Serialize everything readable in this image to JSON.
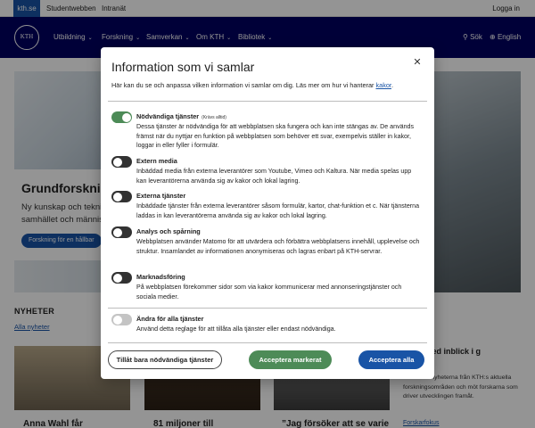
{
  "topbar": {
    "kth": "kth.se",
    "studentwebben": "Studentwebben",
    "intranat": "Intranät",
    "login": "Logga in"
  },
  "logo_text": "KTH",
  "nav": {
    "items": [
      "Utbildning",
      "Forskning",
      "Samverkan",
      "Om KTH",
      "Bibliotek"
    ],
    "search": "Sök",
    "language": "English"
  },
  "hero": {
    "title": "Grundforskni",
    "text": "Ny kunskap och tekni samhället och männis",
    "button": "Forskning för en hållbar"
  },
  "news": {
    "heading": "NYHETER",
    "all_link": "Alla nyheter",
    "items": [
      {
        "title": "Anna Wahl får"
      },
      {
        "title": "81 miljoner till"
      },
      {
        "title": "”Jag försöker att se varie"
      }
    ],
    "side": {
      "title": "heter med inblick i g",
      "text": "e senaste nyheterna från KTH:s aktuella forskningsområden och möt forskarna som driver utvecklingen framåt.",
      "link": "Forskarfokus"
    }
  },
  "modal": {
    "title": "Information som vi samlar",
    "intro_text": "Här kan du se och anpassa vilken information vi samlar om dig. Läs mer om hur vi hanterar",
    "intro_link": "kakor",
    "close_icon": "close-icon",
    "categories": [
      {
        "title": "Nödvändiga tjänster",
        "note": "(Krävs alltid)",
        "state": "on",
        "description": "Dessa tjänster är nödvändiga för att webbplatsen ska fungera och kan inte stängas av. De används främst när du nyttjar en funktion på webbplatsen som behöver ett svar, exempelvis ställer in kakor, loggar in eller fyller i formulär."
      },
      {
        "title": "Extern media",
        "state": "off",
        "description": "Inbäddad media från externa leverantörer som Youtube, Vimeo och Kaltura. När media spelas upp kan leverantörerna använda sig av kakor och lokal lagring."
      },
      {
        "title": "Externa tjänster",
        "state": "off",
        "description": "Inbäddade tjänster från externa leverantörer såsom formulär, kartor, chat-funktion et c. När tjänsterna laddas in kan leverantörerna använda sig av kakor och lokal lagring."
      },
      {
        "title": "Analys och spårning",
        "state": "off",
        "description": "Webbplatsen använder Matomo för att utvärdera och förbättra webbplatsens innehåll, upplevelse och struktur. Insamlandet av informationen anonymiseras och lagras enbart på KTH-servrar."
      },
      {
        "title": "Marknadsföring",
        "state": "off",
        "description": "På webbplatsen förekommer sidor som via kakor kommunicerar med annonseringstjänster och sociala medier."
      }
    ],
    "all_toggle": {
      "title": "Ändra för alla tjänster",
      "state": "off",
      "description": "Använd detta reglage för att tillåta alla tjänster eller endast nödvändiga."
    },
    "buttons": {
      "necessary": "Tillåt bara nödvändiga tjänster",
      "selected": "Acceptera markerat",
      "all": "Acceptera alla"
    }
  },
  "colors": {
    "kth_navy": "#000061",
    "kth_blue": "#1954a6",
    "toggle_on": "#4d8b57",
    "toggle_off": "#323232"
  }
}
